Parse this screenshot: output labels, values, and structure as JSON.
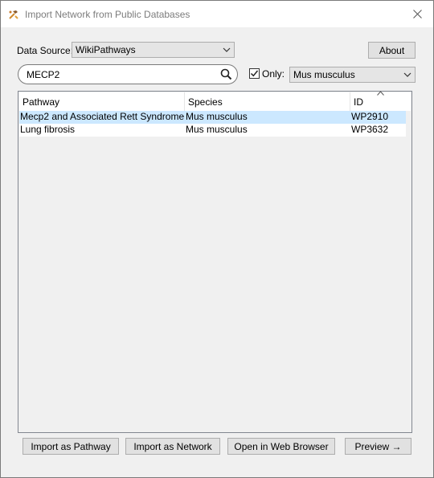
{
  "window": {
    "title": "Import Network from Public Databases"
  },
  "data_source": {
    "label": "Data Source:",
    "selected": "WikiPathways"
  },
  "about_label": "About",
  "search": {
    "value": "MECP2"
  },
  "only": {
    "label": "Only:",
    "checked": true,
    "species_selected": "Mus musculus"
  },
  "table": {
    "columns": [
      "Pathway",
      "Species",
      "ID"
    ],
    "rows": [
      {
        "pathway": "Mecp2 and Associated Rett Syndrome",
        "species": "Mus musculus",
        "id": "WP2910",
        "selected": true
      },
      {
        "pathway": "Lung fibrosis",
        "species": "Mus musculus",
        "id": "WP3632",
        "selected": false
      }
    ]
  },
  "buttons": {
    "import_pathway": "Import as Pathway",
    "import_network": "Import as Network",
    "open_browser": "Open in Web Browser",
    "preview": "Preview →"
  },
  "icons": {
    "app": "hammer-wrench-icon",
    "close": "close-icon",
    "search": "search-icon",
    "sort": "sort-ascending-icon",
    "chevron": "chevron-down-icon"
  },
  "colors": {
    "selection": "#cce8ff",
    "accent": "#e5e5e5"
  }
}
